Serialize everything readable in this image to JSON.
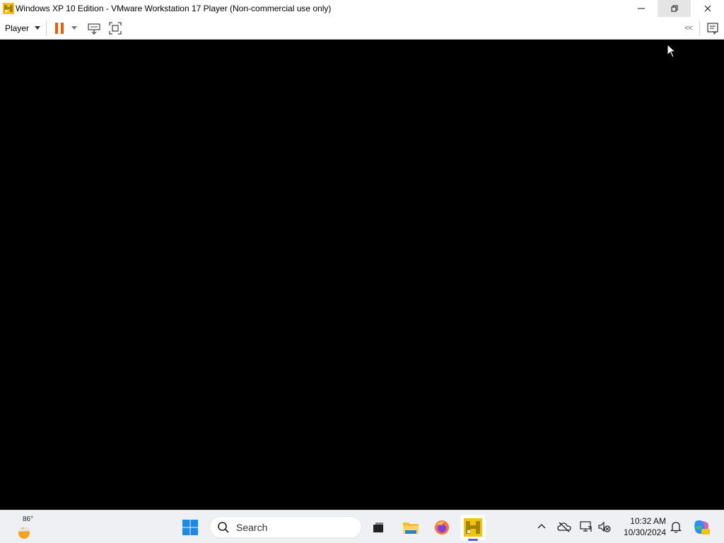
{
  "window": {
    "title": "Windows XP 10 Edition - VMware Workstation 17 Player (Non-commercial use only)",
    "icon": "vmware-player-icon",
    "controls": [
      "minimize-icon",
      "restore-icon",
      "close-icon"
    ]
  },
  "toolbar": {
    "player_menu_label": "Player",
    "pause_icon": "pause-icon",
    "send_keys_icon": "send-ctrl-alt-del-icon",
    "fullscreen_icon": "fullscreen-icon",
    "collapse_label": "<<",
    "notes_icon": "message-log-icon"
  },
  "taskbar": {
    "weather_temp": "86°",
    "search_placeholder": "Search",
    "pinned_apps": [
      "task-view-icon",
      "file-explorer-icon",
      "firefox-icon",
      "vmware-player-icon"
    ],
    "active_app": "vmware-player-icon",
    "tray_icons": [
      "chevron-up-icon",
      "onedrive-icon",
      "network-icon",
      "volume-muted-icon"
    ],
    "clock_time": "10:32 AM",
    "clock_date": "10/30/2024"
  },
  "colors": {
    "pause_accent": "#f25c05",
    "vm_screen": "#000000",
    "taskbar_bg": "#eef0f3",
    "active_indicator": "#5b5fc7"
  }
}
